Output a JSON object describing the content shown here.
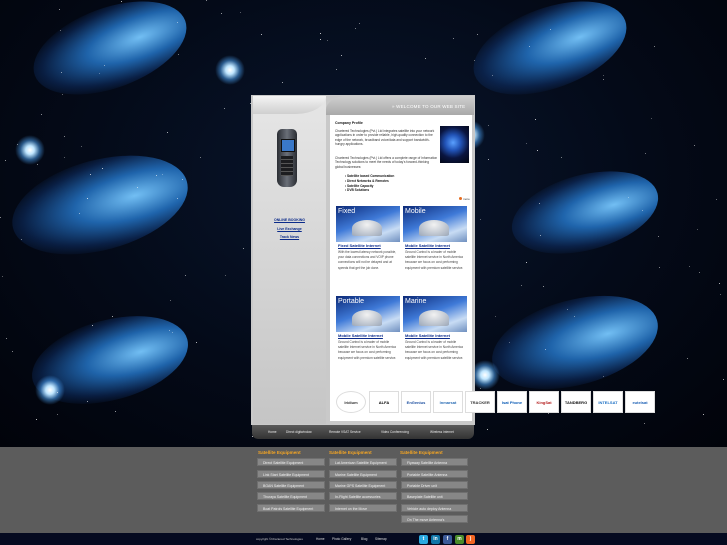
{
  "header": {
    "welcome": "WELCOME TO OUR WEB SITE"
  },
  "sidebar": {
    "links": [
      "ONLINE BOOKING",
      "Live Exchange",
      "Track News"
    ]
  },
  "profile": {
    "title": "Company Profile",
    "para1": "Chartered Technologies (Pvt.) Ltd integrates satellite into your network applications in order to provide reliable, high-quality connection to the edge of the network, broadband voice/data and support bandwidth-hungry applications.",
    "para2": "Chartered Technologies (Pvt.) Ltd offers a complete range of Information Technology solutions to meet the needs of today's forward-thinking global businesses:",
    "services": [
      "Satellite based Communication",
      "Direct Networks & Remotes",
      "Satellite Capacity",
      "DVB Solutions"
    ],
    "more": "more"
  },
  "cards": [
    {
      "title": "Fixed",
      "link": "Fixed Satellite Internet",
      "text": "With the lowest latency network possible, your data connections and VOIP phone connections will not be delayed and at speeds that get the job done."
    },
    {
      "title": "Mobile",
      "link": "Mobile Satellite Internet",
      "text": "Ground Control is a leader of mobile satellite Internet service in North America because we focus on cost performing equipment with premium satellite service."
    },
    {
      "title": "Portable",
      "link": "Mobile Satellite Internet",
      "text": "Ground Control is a leader of mobile satellite Internet service in North America because we focus on cost performing equipment with premium satellite service."
    },
    {
      "title": "Marine",
      "link": "Mobile Satellite Internet",
      "text": "Ground Control is a leader of mobile satellite Internet service in North America because we focus on cost performing equipment with premium satellite service."
    }
  ],
  "logos": [
    "Iridium",
    "ALFA",
    "EnGenius",
    "Inmarsat",
    "TRACKER",
    "Isat Phone",
    "KingSat",
    "TANDBERG",
    "INTELSAT",
    "eutelsat"
  ],
  "nav": [
    "Home",
    "Direct digitwindow",
    "Remote VSAT Service",
    "Video Conferencing",
    "Wireless internet"
  ],
  "footer": {
    "col1": {
      "heading": "Satellite Equipment",
      "items": [
        "Direct Satellite Equipment",
        "Link Start Satellite Equipment",
        "BGAN Satellite Equipment",
        "Thuraya Satellite Equipment",
        "Boat Patrols Satellite Equipment"
      ]
    },
    "col2": {
      "heading": "Satellite Equipment",
      "items": [
        "Lat American Satellite Equipment",
        "Marine Satellite Equipment",
        "Marine GPS Satellite Equipment",
        "In-Flight Satellite accessories",
        "Internet on the Move"
      ]
    },
    "col3": {
      "heading": "Satellite Equipment",
      "items": [
        "Flyaway Satellite Antenna",
        "Portable Satellite Antenna",
        "Portable Driver unit",
        "Baseplate Satellite unit",
        "Vehicle auto deploy Antenna",
        "On The move Antenna's"
      ]
    },
    "copyright": "copyright ©Chartered Technologies",
    "links": [
      "Home",
      "Photo Gallery",
      "Blog",
      "Sitemap"
    ],
    "social": [
      "twitter-icon",
      "linkedin-icon",
      "facebook-icon",
      "myspace-icon",
      "rss-icon"
    ]
  }
}
